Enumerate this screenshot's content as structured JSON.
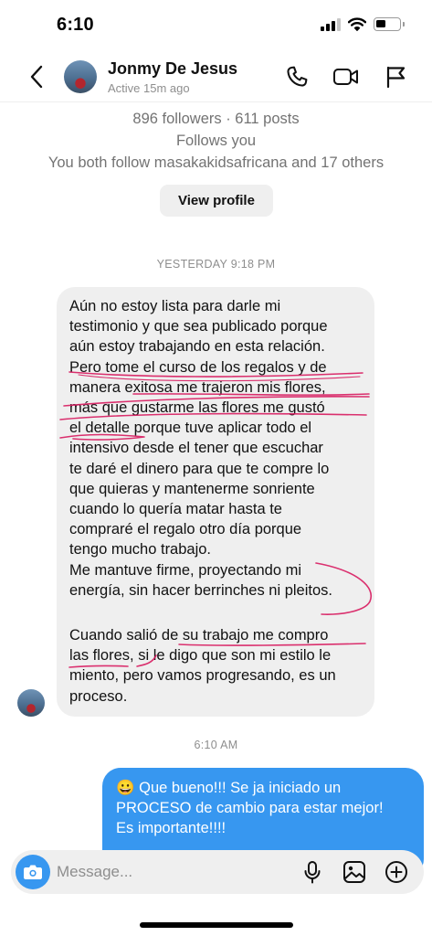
{
  "status_bar": {
    "time": "6:10",
    "icons": [
      "cellular-signal-icon",
      "wifi-icon",
      "battery-icon"
    ],
    "battery_level": 0.45
  },
  "header": {
    "name": "Jonmy De Jesus",
    "status": "Active 15m ago",
    "icons": [
      "back-chevron-icon",
      "phone-icon",
      "video-camera-icon",
      "flag-icon"
    ]
  },
  "profile": {
    "stats": "896 followers · 611 posts",
    "follows_you": "Follows you",
    "mutual": "You both follow masakakidsafricana and 17 others",
    "view_profile_label": "View profile"
  },
  "thread": {
    "timestamp_1": "YESTERDAY 9:18 PM",
    "received_message": {
      "paragraph_1": "Aún no estoy lista para darle mi\ntestimonio y que sea publicado porque\naún estoy trabajando en esta relación.\nPero tome el curso de los regalos y de\nmanera exitosa me trajeron mis flores,\nmás que gustarme las flores me gustó\nel detalle porque tuve aplicar todo el\nintensivo desde el tener que escuchar\nte daré el dinero para que te compre lo\nque quieras y mantenerme sonriente\ncuando lo quería matar hasta te\ncompraré el regalo otro día porque\ntengo mucho trabajo.\nMe mantuve firme, proyectando mi\nenergía, sin hacer berrinches ni pleitos.",
      "paragraph_2": "Cuando salió de su trabajo me compro\nlas flores, si le digo que son mi estilo le\nmiento, pero vamos progresando, es un\nproceso."
    },
    "timestamp_2": "6:10 AM",
    "sent_message": "😀 Que bueno!!! Se ja iniciado un\nPROCESO de cambio para estar mejor!\nEs importante!!!!"
  },
  "composer": {
    "placeholder": "Message...",
    "icons": [
      "camera-icon",
      "microphone-icon",
      "image-icon",
      "add-circle-icon"
    ]
  },
  "colors": {
    "accent_blue": "#3797f0",
    "bubble_gray": "#efefef",
    "ink_annotation": "#d81b60",
    "muted_text": "#737373"
  }
}
